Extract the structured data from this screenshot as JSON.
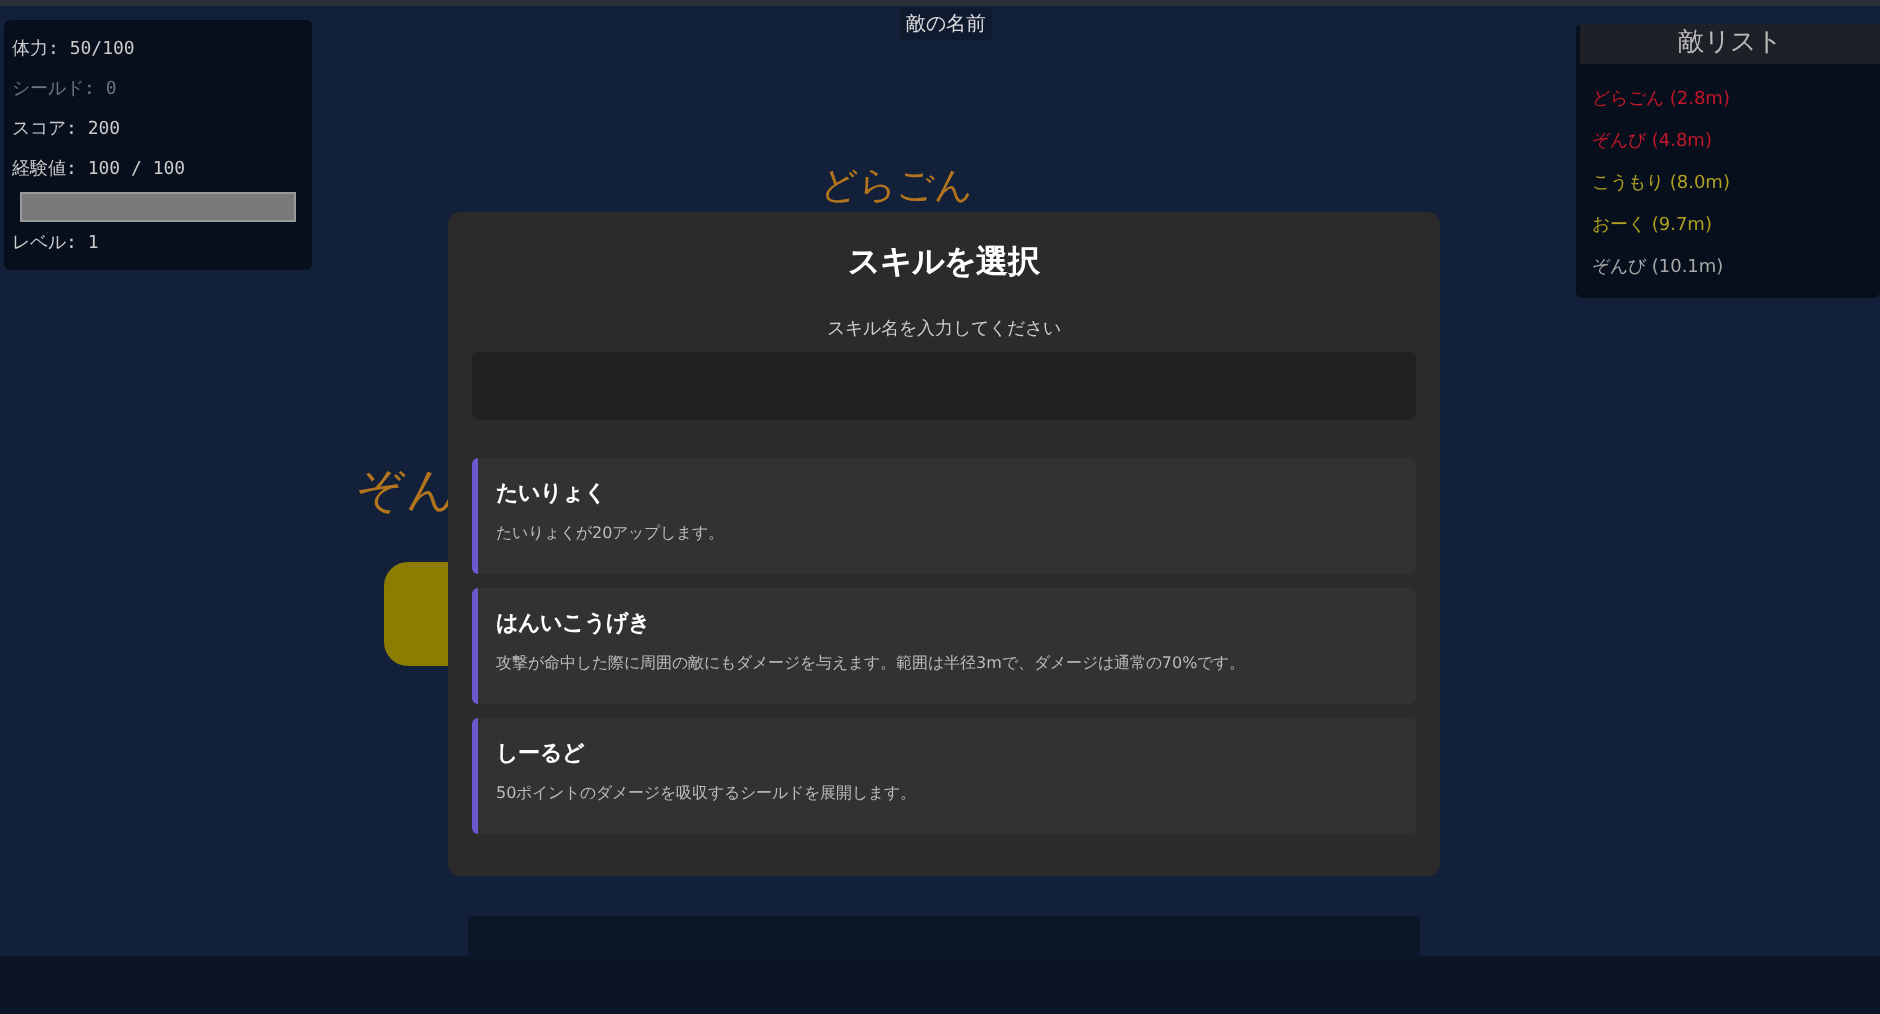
{
  "target_label": "敵の名前",
  "stats": {
    "lines": [
      {
        "text": "体力: 50/100",
        "disabled": false
      },
      {
        "text": "シールド: 0",
        "disabled": true
      },
      {
        "text": "スコア: 200",
        "disabled": false
      },
      {
        "text": "経験値: 100 / 100",
        "disabled": false
      }
    ],
    "exp_bar": {
      "level": 1
    },
    "level_text": "レベル: 1"
  },
  "enemy_list": {
    "title": "敵リスト",
    "items": [
      {
        "text": "どらごん (2.8m)",
        "color": "#c0182a"
      },
      {
        "text": "ぞんび (4.8m)",
        "color": "#c0182a"
      },
      {
        "text": "こうもり (8.0m)",
        "color": "#b0a020"
      },
      {
        "text": "おーく (9.7m)",
        "color": "#b0a020"
      },
      {
        "text": "ぞんび (10.1m)",
        "color": "#a8a8a8"
      }
    ]
  },
  "field_labels": [
    {
      "text": "どらごん"
    },
    {
      "text": "ぞん"
    }
  ],
  "dialog": {
    "title": "スキルを選択",
    "prompt": "スキル名を入力してください",
    "skills": [
      {
        "name": "たいりょく",
        "description": "たいりょくが20アップします。"
      },
      {
        "name": "はんいこうげき",
        "description": "攻撃が命中した際に周囲の敵にもダメージを与えます。範囲は半径3mで、ダメージは通常の70%です。"
      },
      {
        "name": "しーるど",
        "description": "50ポイントのダメージを吸収するシールドを展開します。"
      }
    ]
  }
}
